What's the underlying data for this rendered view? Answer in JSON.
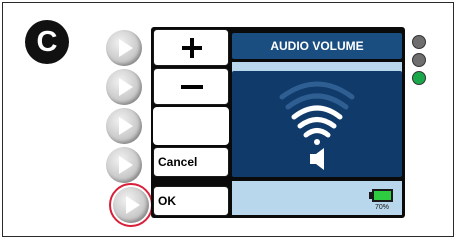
{
  "figure_label": "C",
  "screen": {
    "title": "AUDIO VOLUME",
    "soft_keys": {
      "increase_symbol": "+",
      "decrease_symbol": "−",
      "cancel_label": "Cancel",
      "ok_label": "OK"
    },
    "battery": {
      "percent_label": "70%",
      "level": 0.7
    }
  },
  "indicator_leds": [
    {
      "state": "off",
      "color": "#6e6e6e"
    },
    {
      "state": "off",
      "color": "#6e6e6e"
    },
    {
      "state": "on",
      "color": "#1aa84a"
    }
  ],
  "colors": {
    "title_bar": "#1a4d80",
    "volume_panel": "#0f3a6a",
    "light_panel": "#b8d7ec",
    "ok_highlight_ring": "#d8203a"
  },
  "icons": {
    "side_buttons": "play-arrow-icon",
    "volume_level": "wifi-waves-icon",
    "speaker": "speaker-icon",
    "battery": "battery-icon"
  }
}
